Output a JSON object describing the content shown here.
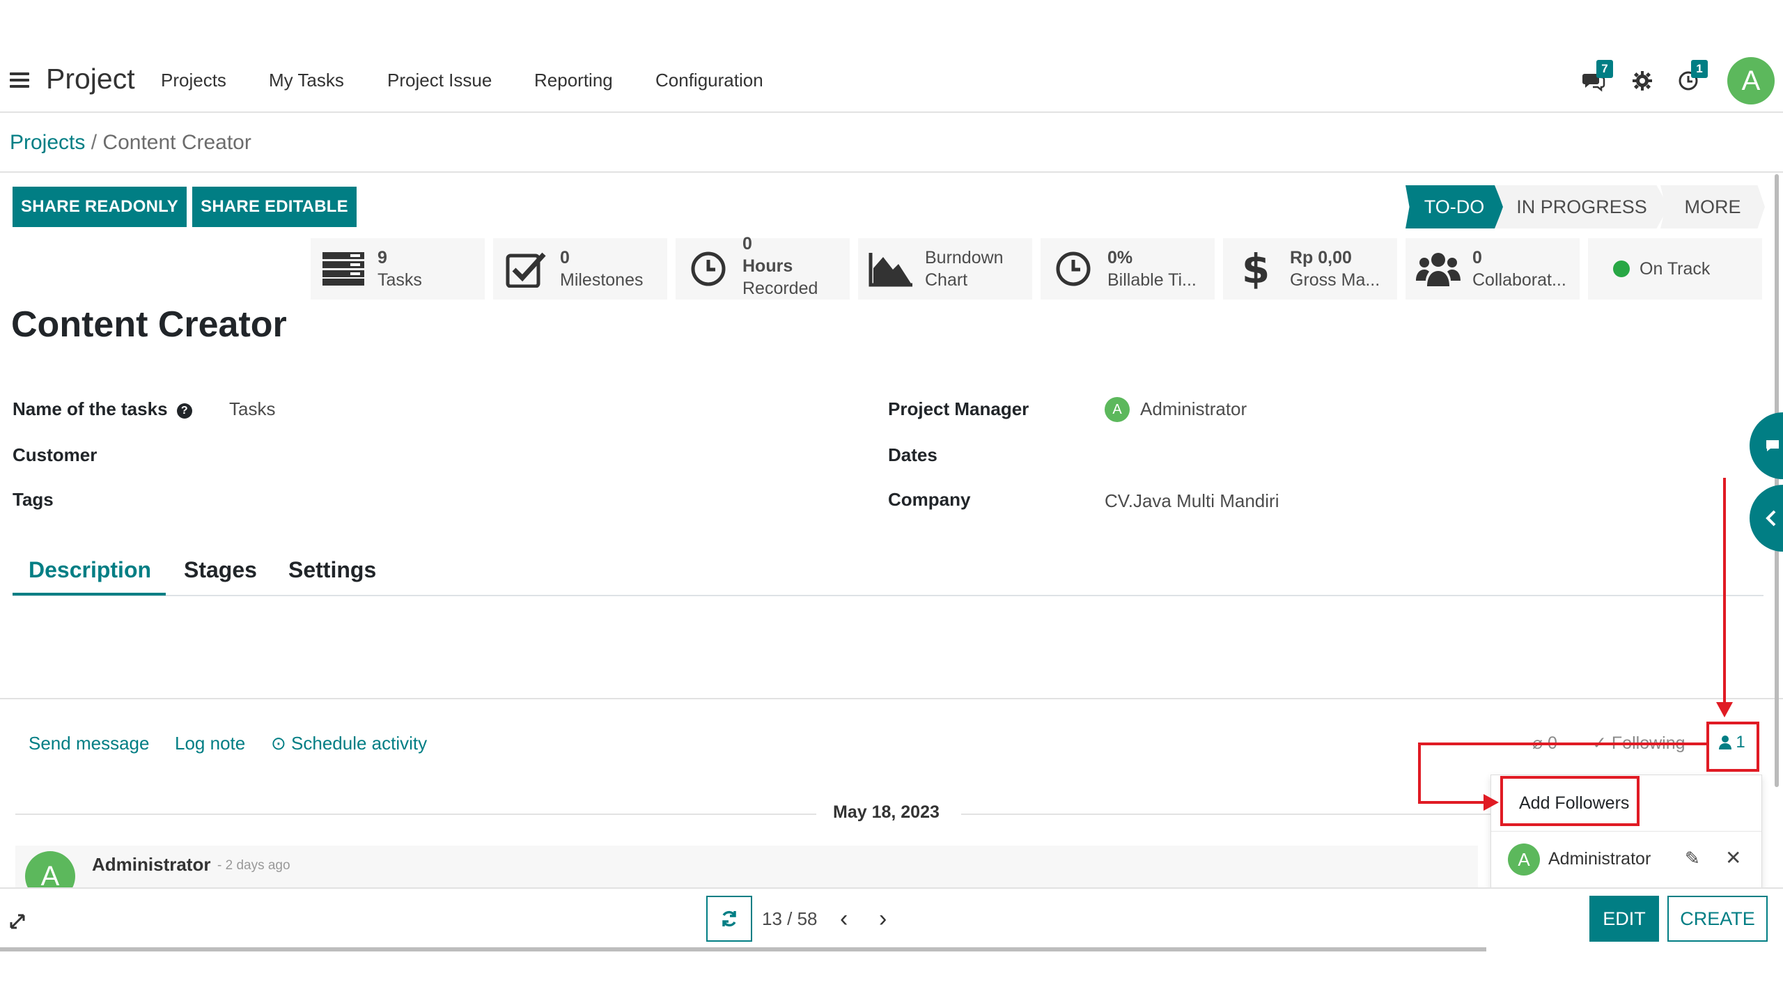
{
  "nav": {
    "app_title": "Project",
    "menu": [
      "Projects",
      "My Tasks",
      "Project Issue",
      "Reporting",
      "Configuration"
    ],
    "messages_badge": "7",
    "activities_badge": "1",
    "user_initial": "A"
  },
  "breadcrumb": {
    "parent": "Projects",
    "separator": "/",
    "current": "Content Creator"
  },
  "actions": {
    "share_readonly": "SHARE READONLY",
    "share_editable": "SHARE EDITABLE"
  },
  "stages": {
    "todo": "TO-DO",
    "in_progress": "IN PROGRESS",
    "more": "MORE"
  },
  "stats": {
    "tasks": {
      "value": "9",
      "label": "Tasks"
    },
    "milestones": {
      "value": "0",
      "label": "Milestones"
    },
    "hours": {
      "value": "0",
      "label": "Hours",
      "label2": "Recorded"
    },
    "burndown": {
      "label": "Burndown",
      "label2": "Chart"
    },
    "billable": {
      "value": "0%",
      "label": "Billable Ti..."
    },
    "gross": {
      "value": "Rp 0,00",
      "label": "Gross Ma..."
    },
    "collaborators": {
      "value": "0",
      "label": "Collaborat..."
    },
    "status": {
      "label": "On Track",
      "color": "#28a745"
    }
  },
  "record": {
    "title": "Content Creator",
    "fields_left": {
      "name_of_tasks_label": "Name of the tasks",
      "name_of_tasks_value": "Tasks",
      "customer_label": "Customer",
      "tags_label": "Tags"
    },
    "fields_right": {
      "manager_label": "Project Manager",
      "manager_initial": "A",
      "manager_value": "Administrator",
      "dates_label": "Dates",
      "company_label": "Company",
      "company_value": "CV.Java Multi Mandiri"
    }
  },
  "tabs": [
    "Description",
    "Stages",
    "Settings"
  ],
  "chatter": {
    "send_message": "Send message",
    "log_note": "Log note",
    "schedule_activity": "Schedule activity",
    "attachments_count": "0",
    "following": "Following",
    "followers_count": "1",
    "date": "May 18, 2023",
    "message_author": "Administrator",
    "message_time": "- 2 days ago",
    "author_initial": "A"
  },
  "followers_dropdown": {
    "add_followers": "Add Followers",
    "follower_initial": "A",
    "follower_name": "Administrator"
  },
  "bottom": {
    "pager": "13 / 58",
    "edit": "EDIT",
    "create": "CREATE"
  },
  "colors": {
    "accent": "#017e84",
    "avatar": "#5cb85c",
    "annotation": "#e01b24"
  }
}
